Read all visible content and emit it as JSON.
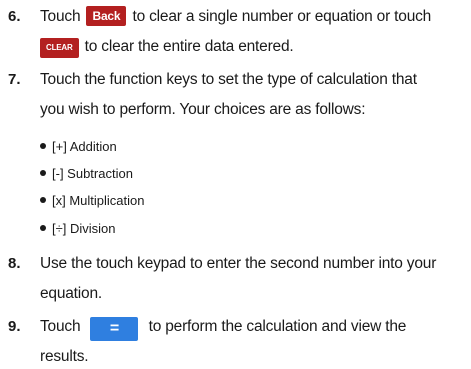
{
  "steps": [
    {
      "number": "6.",
      "text_a": "Touch",
      "back_label": "Back",
      "text_b": "to clear a single number or equation or touch",
      "clear_label": "CLEAR",
      "text_c": "to clear the entire data entered."
    },
    {
      "number": "7.",
      "line1": "Touch the function keys to set the type of calculation that",
      "line2": "you wish to perform. Your choices are as follows:",
      "bullets": [
        "[+] Addition",
        "[-] Subtraction",
        "[x] Multiplication",
        "[÷] Division"
      ]
    },
    {
      "number": "8.",
      "line1": "Use the touch keypad to enter the second number into your",
      "line2": "equation."
    },
    {
      "number": "9.",
      "text_a": "Touch",
      "equals_label": "=",
      "text_b": "to perform the calculation and view the",
      "line2": "results."
    }
  ]
}
